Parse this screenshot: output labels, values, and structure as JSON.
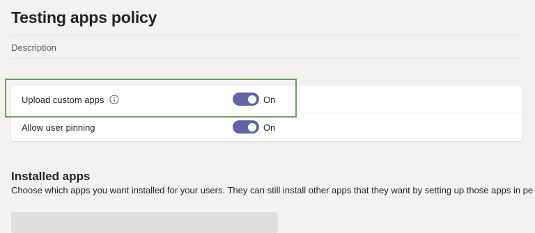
{
  "page": {
    "title": "Testing apps policy",
    "description_label": "Description"
  },
  "settings": [
    {
      "label": "Upload custom apps",
      "has_info_icon": true,
      "state_label": "On",
      "enabled": true
    },
    {
      "label": "Allow user pinning",
      "has_info_icon": false,
      "state_label": "On",
      "enabled": true
    }
  ],
  "installed_apps": {
    "title": "Installed apps",
    "description": "Choose which apps you want installed for your users. They can still install other apps that they want by setting up those apps in pe"
  },
  "colors": {
    "toggle_on": "#6264a7",
    "highlight": "#6a9e62",
    "background": "#f3f2f1"
  },
  "icons": {
    "info": "info-icon"
  }
}
